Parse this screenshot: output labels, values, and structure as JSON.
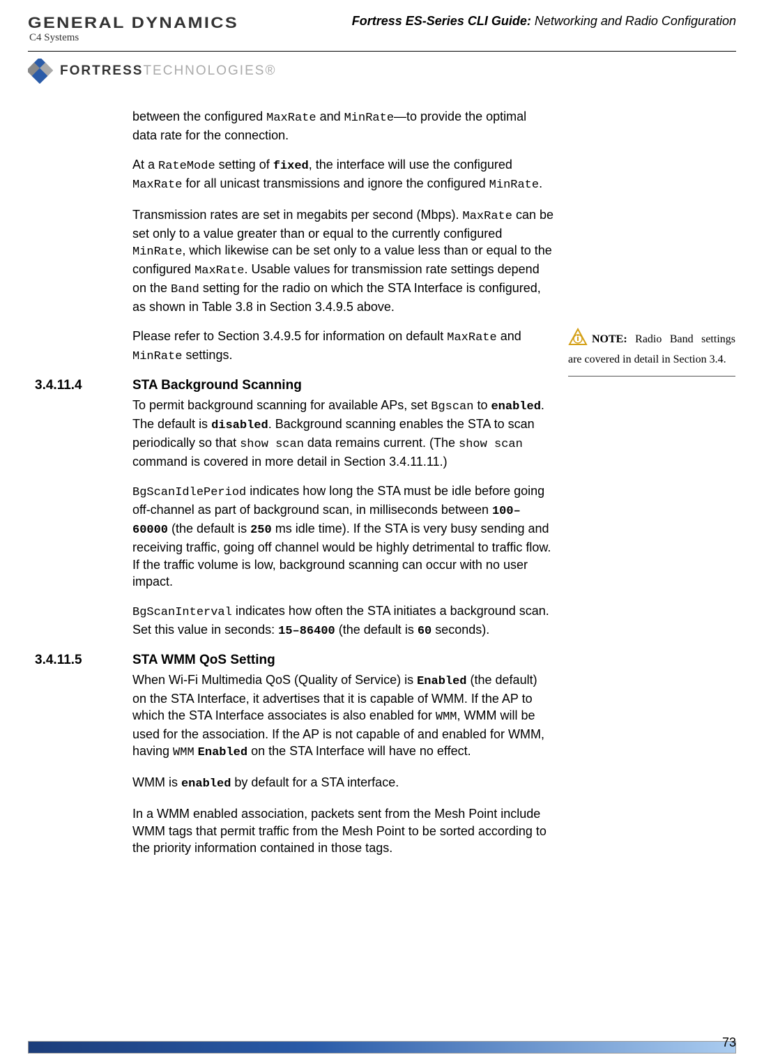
{
  "header": {
    "logo_gd": "GENERAL DYNAMICS",
    "logo_c4": "C4 Systems",
    "title_bold": "Fortress ES-Series CLI Guide:",
    "title_rest": " Networking and Radio Configuration",
    "fortress_bold": "FORTRESS",
    "fortress_tech": "TECHNOLOGIES"
  },
  "paragraphs": {
    "p1_a": "between the configured ",
    "p1_b": "MaxRate",
    "p1_c": " and ",
    "p1_d": "MinRate",
    "p1_e": "—to provide the optimal data rate for the connection.",
    "p2_a": "At a ",
    "p2_b": "RateMode",
    "p2_c": " setting of ",
    "p2_d": "fixed",
    "p2_e": ", the interface will use the configured ",
    "p2_f": "MaxRate",
    "p2_g": " for all unicast transmissions and ignore the configured ",
    "p2_h": "MinRate",
    "p2_i": ".",
    "p3_a": "Transmission rates are set in megabits per second (Mbps). ",
    "p3_b": "MaxRate",
    "p3_c": " can be set only to a value greater than or equal to the currently configured ",
    "p3_d": "MinRate",
    "p3_e": ", which likewise can be set only to a value less than or equal to the configured ",
    "p3_f": "MaxRate",
    "p3_g": ". Usable values for transmission rate settings depend on the ",
    "p3_h": "Band",
    "p3_i": " setting for the radio on which the STA Interface is configured, as shown in Table 3.8 in Section 3.4.9.5 above.",
    "p4_a": "Please refer to Section 3.4.9.5 for information on default ",
    "p4_b": "MaxRate",
    "p4_c": " and ",
    "p4_d": "MinRate",
    "p4_e": " settings.",
    "p5_a": "To permit background scanning for available APs, set ",
    "p5_b": "Bgscan",
    "p5_c": " to ",
    "p5_d": "enabled",
    "p5_e": ". The default is ",
    "p5_f": "disabled",
    "p5_g": ". Background scanning enables the STA to scan periodically so that ",
    "p5_h": "show scan",
    "p5_i": " data remains current. (The ",
    "p5_j": "show scan",
    "p5_k": " command is covered in more detail in Section 3.4.11.11.)",
    "p6_a": "BgScanIdlePeriod",
    "p6_b": " indicates how long the STA must be idle before going off-channel as part of background scan, in milliseconds between ",
    "p6_c": "100–60000",
    "p6_d": " (the default is ",
    "p6_e": "250",
    "p6_f": " ms idle time). If the STA is very busy sending and receiving traffic, going off channel would be highly detrimental to traffic flow. If the traffic volume is low, background scanning can occur with no user impact.",
    "p7_a": "BgScanInterval",
    "p7_b": " indicates how often the STA initiates a background scan. Set this value in seconds: ",
    "p7_c": "15–86400",
    "p7_d": " (the default is ",
    "p7_e": "60",
    "p7_f": " seconds).",
    "p8_a": "When Wi-Fi Multimedia QoS (Quality of Service) is ",
    "p8_b": "Enabled",
    "p8_c": " (the default) on the STA Interface, it advertises that it is capable of WMM. If the AP to which the STA Interface associates is also enabled for ",
    "p8_d": "WMM",
    "p8_e": ", WMM will be used for the association. If the AP is not capable of and enabled for WMM, having ",
    "p8_f": "WMM",
    "p8_g": " ",
    "p8_h": "Enabled",
    "p8_i": " on the STA Interface will have no effect.",
    "p9_a": "WMM is ",
    "p9_b": "enabled",
    "p9_c": " by default for a STA interface.",
    "p10": "In a WMM enabled association, packets sent from the Mesh Point include WMM tags that permit traffic from the Mesh Point to be sorted according to the priority information contained in those tags."
  },
  "sections": {
    "s1_num": "3.4.11.4",
    "s1_title": "STA Background Scanning",
    "s2_num": "3.4.11.5",
    "s2_title": "STA WMM QoS Setting"
  },
  "note": {
    "label": "NOTE:",
    "text": " Radio Band settings are covered in detail in Section 3.4."
  },
  "footer": {
    "page_number": "73"
  }
}
